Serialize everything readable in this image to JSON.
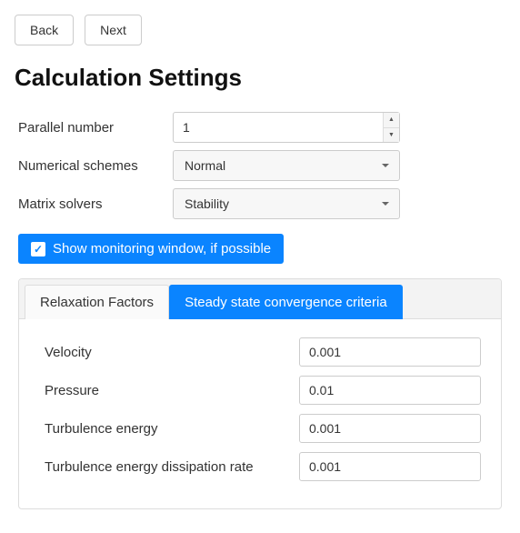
{
  "nav": {
    "back": "Back",
    "next": "Next"
  },
  "title": "Calculation Settings",
  "settings": {
    "parallel_label": "Parallel number",
    "parallel_value": "1",
    "schemes_label": "Numerical schemes",
    "schemes_value": "Normal",
    "solvers_label": "Matrix solvers",
    "solvers_value": "Stability",
    "monitoring_label": "Show monitoring window, if possible"
  },
  "tabs": {
    "relaxation": "Relaxation Factors",
    "convergence": "Steady state convergence criteria"
  },
  "criteria": {
    "velocity_label": "Velocity",
    "velocity_value": "0.001",
    "pressure_label": "Pressure",
    "pressure_value": "0.01",
    "turb_energy_label": "Turbulence energy",
    "turb_energy_value": "0.001",
    "turb_diss_label": "Turbulence energy dissipation rate",
    "turb_diss_value": "0.001"
  }
}
